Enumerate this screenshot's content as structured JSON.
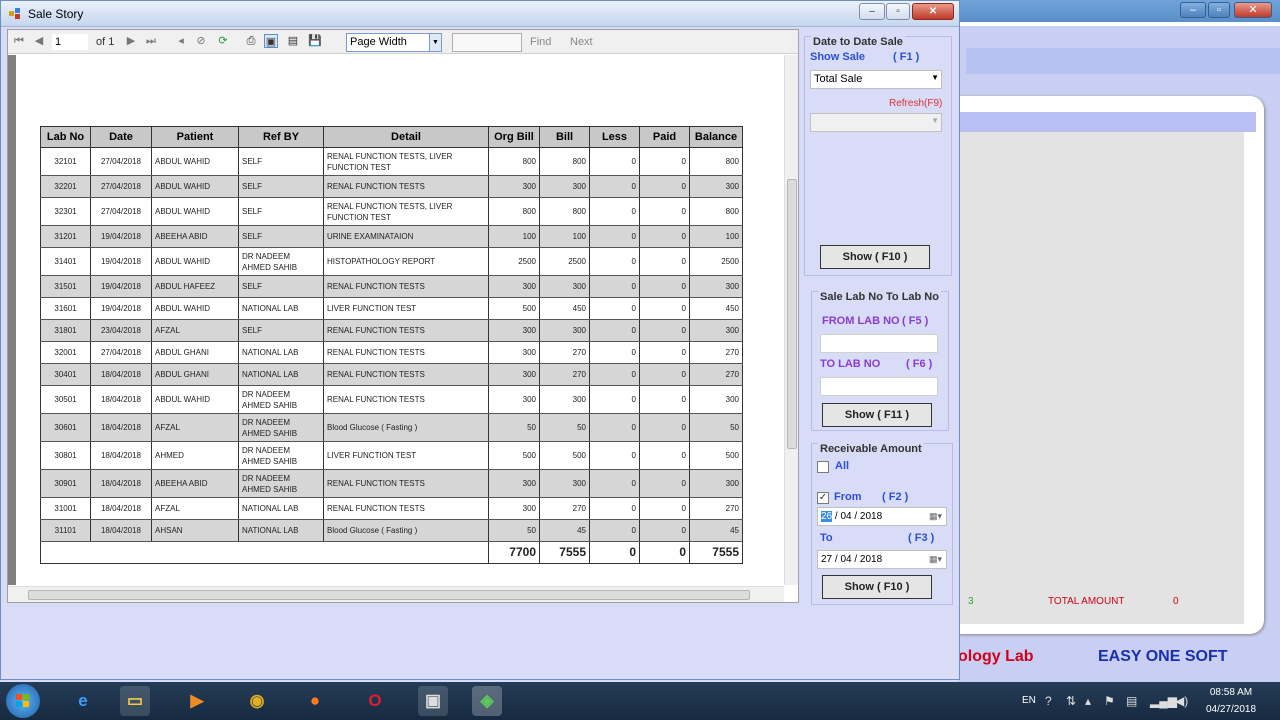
{
  "window": {
    "title": "Sale Story"
  },
  "toolbar": {
    "page_current": "1",
    "page_of": "of 1",
    "zoom": "Page Width",
    "find_label": "Find",
    "next_label": "Next"
  },
  "table": {
    "headers": [
      "Lab No",
      "Date",
      "Patient",
      "Ref BY",
      "Detail",
      "Org Bill",
      "Bill",
      "Less",
      "Paid",
      "Balance"
    ],
    "rows": [
      [
        "32101",
        "27/04/2018",
        "ABDUL WAHID",
        "SELF",
        "RENAL FUNCTION TESTS, LIVER FUNCTION TEST",
        "800",
        "800",
        "0",
        "0",
        "800"
      ],
      [
        "32201",
        "27/04/2018",
        "ABDUL WAHID",
        "SELF",
        "RENAL FUNCTION TESTS",
        "300",
        "300",
        "0",
        "0",
        "300"
      ],
      [
        "32301",
        "27/04/2018",
        "ABDUL WAHID",
        "SELF",
        "RENAL FUNCTION TESTS, LIVER FUNCTION TEST",
        "800",
        "800",
        "0",
        "0",
        "800"
      ],
      [
        "31201",
        "19/04/2018",
        "ABEEHA ABID",
        "SELF",
        "URINE EXAMINATAION",
        "100",
        "100",
        "0",
        "0",
        "100"
      ],
      [
        "31401",
        "19/04/2018",
        "ABDUL WAHID",
        "DR NADEEM AHMED SAHIB",
        "HISTOPATHOLOGY REPORT",
        "2500",
        "2500",
        "0",
        "0",
        "2500"
      ],
      [
        "31501",
        "19/04/2018",
        "ABDUL HAFEEZ",
        "SELF",
        "RENAL FUNCTION TESTS",
        "300",
        "300",
        "0",
        "0",
        "300"
      ],
      [
        "31601",
        "19/04/2018",
        "ABDUL WAHID",
        "NATIONAL LAB",
        "LIVER FUNCTION TEST",
        "500",
        "450",
        "0",
        "0",
        "450"
      ],
      [
        "31801",
        "23/04/2018",
        "AFZAL",
        "SELF",
        "RENAL FUNCTION TESTS",
        "300",
        "300",
        "0",
        "0",
        "300"
      ],
      [
        "32001",
        "27/04/2018",
        "ABDUL GHANI",
        "NATIONAL LAB",
        "RENAL FUNCTION TESTS",
        "300",
        "270",
        "0",
        "0",
        "270"
      ],
      [
        "30401",
        "18/04/2018",
        "ABDUL GHANI",
        "NATIONAL LAB",
        "RENAL FUNCTION TESTS",
        "300",
        "270",
        "0",
        "0",
        "270"
      ],
      [
        "30501",
        "18/04/2018",
        "ABDUL WAHID",
        "DR NADEEM AHMED SAHIB",
        "RENAL FUNCTION TESTS",
        "300",
        "300",
        "0",
        "0",
        "300"
      ],
      [
        "30601",
        "18/04/2018",
        "AFZAL",
        "DR NADEEM AHMED SAHIB",
        "Blood Glucose ( Fasting )",
        "50",
        "50",
        "0",
        "0",
        "50"
      ],
      [
        "30801",
        "18/04/2018",
        "AHMED",
        "DR NADEEM AHMED SAHIB",
        "LIVER FUNCTION TEST",
        "500",
        "500",
        "0",
        "0",
        "500"
      ],
      [
        "30901",
        "18/04/2018",
        "ABEEHA ABID",
        "DR NADEEM AHMED SAHIB",
        "RENAL FUNCTION TESTS",
        "300",
        "300",
        "0",
        "0",
        "300"
      ],
      [
        "31001",
        "18/04/2018",
        "AFZAL",
        "NATIONAL LAB",
        "RENAL FUNCTION TESTS",
        "300",
        "270",
        "0",
        "0",
        "270"
      ],
      [
        "31101",
        "18/04/2018",
        "AHSAN",
        "NATIONAL LAB",
        "Blood Glucose ( Fasting )",
        "50",
        "45",
        "0",
        "0",
        "45"
      ]
    ],
    "totals": [
      "7700",
      "7555",
      "0",
      "0",
      "7555"
    ]
  },
  "date_sale": {
    "title": "Date to Date Sale",
    "show_sale_label": "Show Sale",
    "show_sale_key": "( F1 )",
    "show_sale_value": "Total Sale",
    "refresh_label": "Refresh(F9)",
    "show_button": "Show ( F10 )"
  },
  "lab_no": {
    "title": "Sale Lab No To Lab No",
    "from_label": "FROM LAB NO",
    "from_key": "( F5 )",
    "to_label": "TO LAB NO",
    "to_key": "( F6 )",
    "show_button": "Show ( F11 )"
  },
  "receivable": {
    "title": "Receivable Amount",
    "all_label": "All",
    "from_label": "From",
    "from_key": "( F2 )",
    "from_day": "26",
    "from_rest": " / 04 / 2018",
    "to_label": "To",
    "to_key": "( F3 )",
    "to_date": "27 / 04 / 2018",
    "show_button": "Show ( F10 )"
  },
  "background_app": {
    "three": "3",
    "total_label": "TOTAL AMOUNT",
    "total_value": "0",
    "lab_name": "ology Lab",
    "brand": "EASY ONE SOFT"
  },
  "taskbar": {
    "lang": "EN",
    "time": "08:58 AM",
    "date": "04/27/2018"
  },
  "colors": {
    "accent_blue": "#2c4fd6",
    "accent_purple": "#8c3bd0",
    "refresh_red": "#e03030"
  }
}
